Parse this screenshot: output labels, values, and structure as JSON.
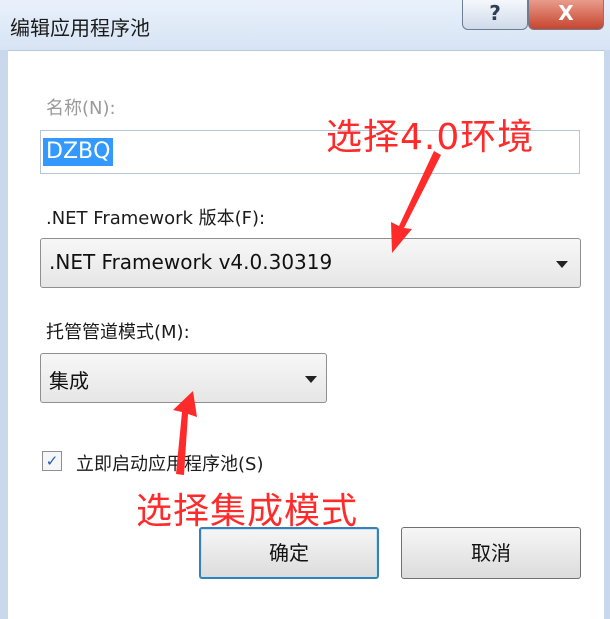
{
  "window": {
    "title": "编辑应用程序池",
    "help_icon": "?",
    "close_icon": "X"
  },
  "form": {
    "name_label": "名称(N):",
    "name_value": "DZBQ",
    "framework_label": ".NET Framework 版本(F):",
    "framework_value": ".NET Framework v4.0.30319",
    "pipeline_label": "托管管道模式(M):",
    "pipeline_value": "集成",
    "start_checkbox_label": "立即启动应用程序池(S)",
    "start_checkbox_checked": true,
    "check_mark": "✓"
  },
  "buttons": {
    "ok_label": "确定",
    "cancel_label": "取消"
  },
  "annotations": {
    "framework_note": "选择4.0环境",
    "pipeline_note": "选择集成模式",
    "color": "#ff2a2a"
  }
}
